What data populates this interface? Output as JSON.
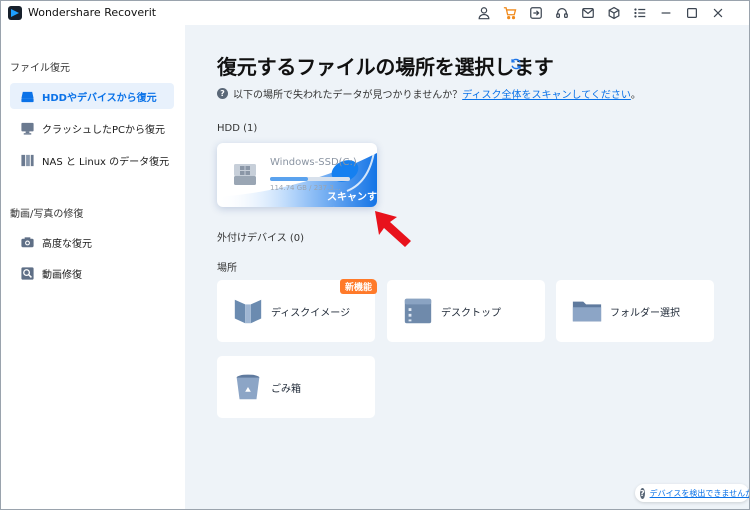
{
  "app": {
    "title": "Wondershare Recoverit"
  },
  "sidebar": {
    "section1": "ファイル復元",
    "items1": [
      {
        "label": "HDDやデバイスから復元",
        "icon": "hdd-icon"
      },
      {
        "label": "クラッシュしたPCから復元",
        "icon": "monitor-icon"
      },
      {
        "label": "NAS と Linux のデータ復元",
        "icon": "nas-icon"
      }
    ],
    "section2": "動画/写真の修復",
    "items2": [
      {
        "label": "高度な復元",
        "icon": "camera-icon"
      },
      {
        "label": "動画修復",
        "icon": "video-repair-icon"
      }
    ]
  },
  "main": {
    "title": "復元するファイルの場所を選択します",
    "hint_text": "以下の場所で失われたデータが見つかりませんか？",
    "hint_link": "ディスク全体をスキャンしてください",
    "hint_end": "。",
    "hdd_label": "HDD (1)",
    "drive": {
      "name": "Windows-SSD(C:)",
      "size": "114.74 GB / 237.3...",
      "used_fraction": 0.48,
      "scan_label": "スキャンする"
    },
    "external_label": "外付けデバイス (0)",
    "location_label": "場所",
    "locations": [
      {
        "label": "ディスクイメージ",
        "badge": "新機能",
        "icon": "disk-image-icon"
      },
      {
        "label": "デスクトップ",
        "icon": "desktop-icon"
      },
      {
        "label": "フォルダー選択",
        "icon": "folder-icon"
      },
      {
        "label": "ごみ箱",
        "icon": "recycle-bin-icon"
      }
    ],
    "help_link": "デバイスを検出できませんか？"
  },
  "colors": {
    "accent": "#0a72e8",
    "badge": "#ff7a2a",
    "pointer": "#e8121c"
  }
}
